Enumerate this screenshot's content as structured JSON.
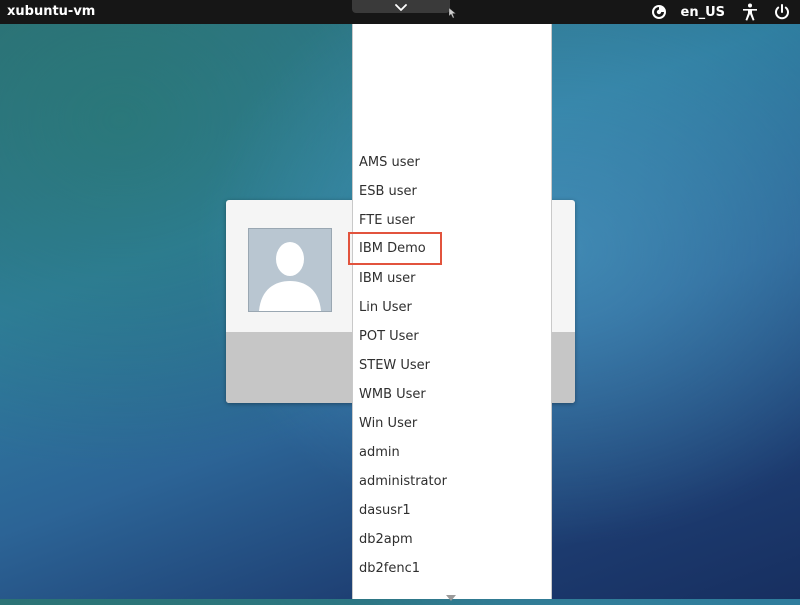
{
  "top_panel": {
    "hostname": "xubuntu-vm",
    "language": "en_US",
    "icons": [
      "session-icon",
      "accessibility-icon",
      "power-icon"
    ]
  },
  "user_list": {
    "users": [
      "AMS user",
      "ESB user",
      "FTE user",
      "IBM Demo",
      "IBM user",
      "Lin User",
      "POT User",
      "STEW User",
      "WMB User",
      "Win User",
      "admin",
      "administrator",
      "dasusr1",
      "db2apm",
      "db2fenc1"
    ],
    "highlighted": "IBM Demo",
    "icons": [
      "chevron-down-icon",
      "scroll-down-arrow-icon"
    ]
  },
  "login_card": {
    "avatar_icon": "default-avatar-icon"
  },
  "colors": {
    "panel": "#161616",
    "highlight_border": "#e2533d",
    "list_bg": "#ffffff"
  }
}
